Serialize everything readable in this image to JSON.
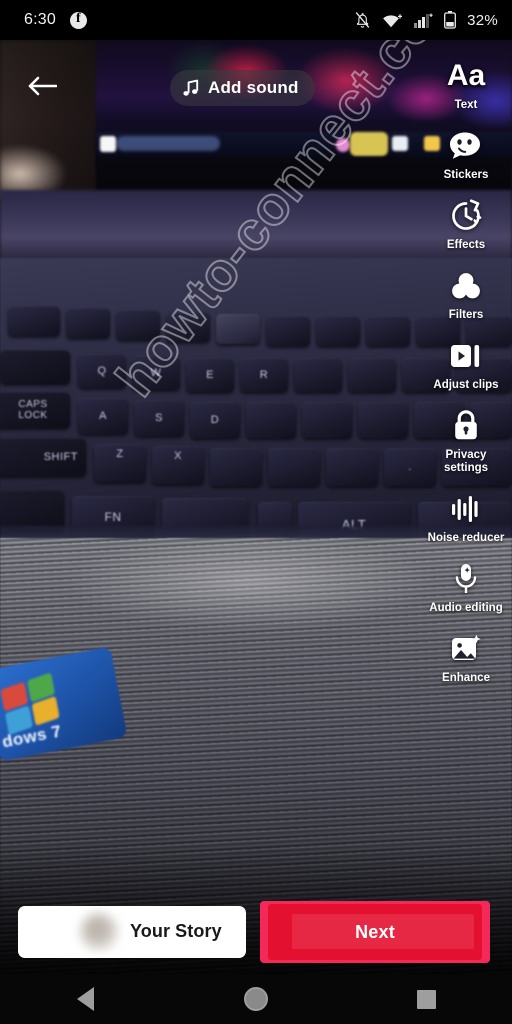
{
  "status_bar": {
    "time": "6:30",
    "app_badge_icon": "facebook-icon",
    "notifications_muted_icon": "bell-muted-icon",
    "wifi_icon": "wifi-icon",
    "signal_icon": "cellular-signal-icon",
    "battery_icon": "battery-icon",
    "battery_percent": "32%"
  },
  "top_bar": {
    "back_icon": "back-arrow-icon",
    "add_sound": {
      "label": "Add sound",
      "icon": "music-note-icon"
    }
  },
  "tool_rail": {
    "items": [
      {
        "label": "Text",
        "icon": "text-aa-icon"
      },
      {
        "label": "Stickers",
        "icon": "sticker-smiley-icon"
      },
      {
        "label": "Effects",
        "icon": "effects-clock-icon"
      },
      {
        "label": "Filters",
        "icon": "filters-circles-icon"
      },
      {
        "label": "Adjust clips",
        "icon": "adjust-clips-icon"
      },
      {
        "label": "Privacy settings",
        "icon": "lock-icon"
      },
      {
        "label": "Noise reducer",
        "icon": "waveform-icon"
      },
      {
        "label": "Audio editing",
        "icon": "microphone-sparkle-icon"
      },
      {
        "label": "Enhance",
        "icon": "image-sparkle-icon"
      }
    ]
  },
  "bottom_bar": {
    "audience_label": "Your Story",
    "audience_avatar": "blurred-avatar",
    "next_label": "Next",
    "next_highlight_color": "#f5285a",
    "next_button_color": "#e41030"
  },
  "nav_bar": {
    "back_icon": "nav-back-triangle-icon",
    "home_icon": "nav-home-circle-icon",
    "recents_icon": "nav-recents-square-icon"
  },
  "background_photo": {
    "watermark_text": "howto-connect.com",
    "sticker_label": "dows 7",
    "subject": "laptop keyboard photo"
  }
}
